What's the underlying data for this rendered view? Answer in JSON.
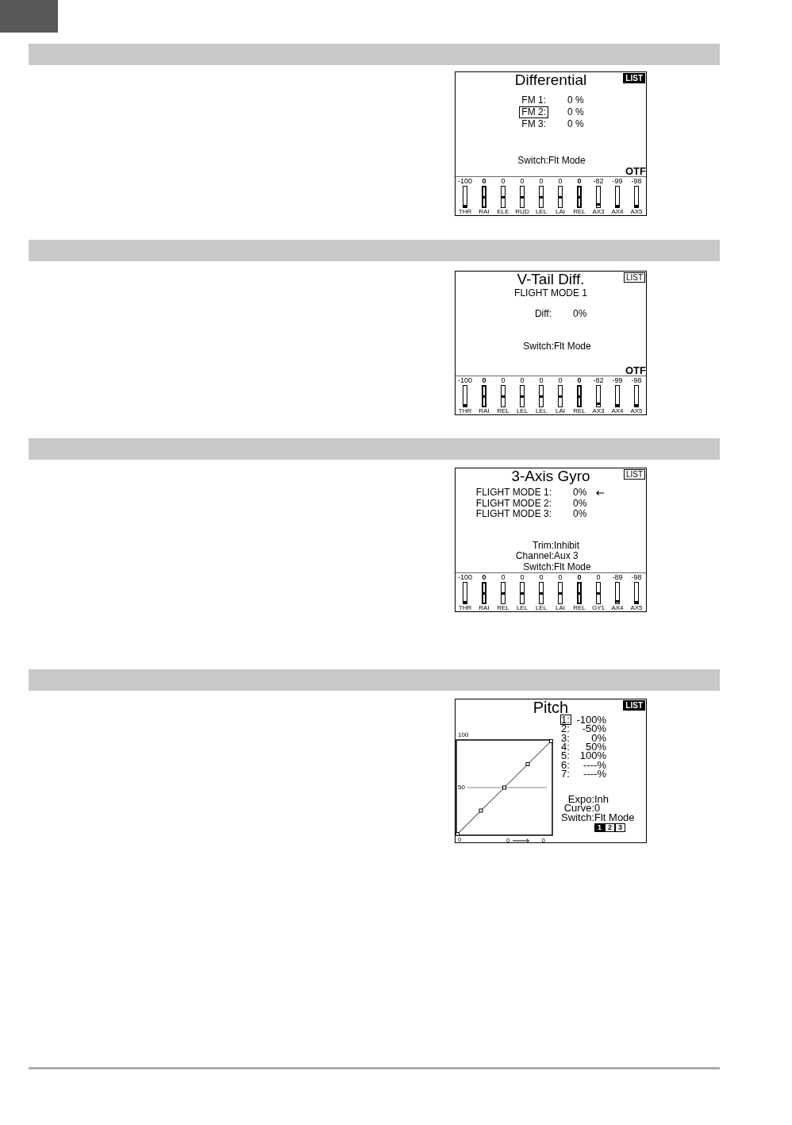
{
  "sections": [
    {
      "screen": {
        "kind": "mix",
        "title": "Differential",
        "list_button": {
          "label": "LIST",
          "selected": true
        },
        "rows": [
          {
            "label": "FM 1:",
            "value": "0 %",
            "selected": false
          },
          {
            "label": "FM 2:",
            "value": "0 %",
            "selected": true
          },
          {
            "label": "FM 3:",
            "value": "0 %",
            "selected": false
          }
        ],
        "settings": [
          {
            "label": "Switch:",
            "value": "Flt Mode"
          }
        ],
        "otf": "OTF",
        "channels": [
          {
            "reading": "-100",
            "name": "THR",
            "level": 0,
            "bold": false
          },
          {
            "reading": "0",
            "name": "RAI",
            "level": 0.5,
            "bold": true
          },
          {
            "reading": "0",
            "name": "ELE",
            "level": 0.5,
            "bold": false
          },
          {
            "reading": "0",
            "name": "RUD",
            "level": 0.5,
            "bold": false
          },
          {
            "reading": "0",
            "name": "LEL",
            "level": 0.5,
            "bold": false
          },
          {
            "reading": "0",
            "name": "LAI",
            "level": 0.5,
            "bold": false
          },
          {
            "reading": "0",
            "name": "REL",
            "level": 0.5,
            "bold": true
          },
          {
            "reading": "-82",
            "name": "AX3",
            "level": 0.09,
            "bold": false
          },
          {
            "reading": "-99",
            "name": "AX4",
            "level": 0.005,
            "bold": false
          },
          {
            "reading": "-98",
            "name": "AX5",
            "level": 0.01,
            "bold": false
          }
        ]
      }
    },
    {
      "screen": {
        "kind": "mix",
        "title": "V-Tail Diff.",
        "subtitle": "FLIGHT MODE 1",
        "list_button": {
          "label": "LIST",
          "selected": false
        },
        "rows": [
          {
            "label": "Diff:",
            "value": "0%",
            "selected": false
          }
        ],
        "settings": [
          {
            "label": "Switch:",
            "value": "Flt Mode"
          }
        ],
        "otf": "OTF",
        "channels": [
          {
            "reading": "-100",
            "name": "THR",
            "level": 0,
            "bold": false
          },
          {
            "reading": "0",
            "name": "RAI",
            "level": 0.5,
            "bold": true
          },
          {
            "reading": "0",
            "name": "REL",
            "level": 0.5,
            "bold": false
          },
          {
            "reading": "0",
            "name": "LEL",
            "level": 0.5,
            "bold": false
          },
          {
            "reading": "0",
            "name": "LEL",
            "level": 0.5,
            "bold": false
          },
          {
            "reading": "0",
            "name": "LAI",
            "level": 0.5,
            "bold": false
          },
          {
            "reading": "0",
            "name": "REL",
            "level": 0.5,
            "bold": true
          },
          {
            "reading": "-82",
            "name": "AX3",
            "level": 0.09,
            "bold": false
          },
          {
            "reading": "-99",
            "name": "AX4",
            "level": 0.005,
            "bold": false
          },
          {
            "reading": "-98",
            "name": "AX5",
            "level": 0.01,
            "bold": false
          }
        ]
      }
    },
    {
      "screen": {
        "kind": "mix",
        "title": "3-Axis Gyro",
        "list_button": {
          "label": "LIST",
          "selected": false
        },
        "rows": [
          {
            "label": "FLIGHT MODE 1:",
            "value": "0%",
            "selected": false,
            "active": true
          },
          {
            "label": "FLIGHT MODE 2:",
            "value": "0%",
            "selected": false,
            "active": false
          },
          {
            "label": "FLIGHT MODE 3:",
            "value": "0%",
            "selected": false,
            "active": false
          }
        ],
        "settings": [
          {
            "label": "Trim:",
            "value": "Inhibit"
          },
          {
            "label": "Channel:",
            "value": "Aux 3"
          },
          {
            "label": "Switch:",
            "value": "Flt Mode"
          }
        ],
        "channels": [
          {
            "reading": "-100",
            "name": "THR",
            "level": 0,
            "bold": false
          },
          {
            "reading": "0",
            "name": "RAI",
            "level": 0.5,
            "bold": true
          },
          {
            "reading": "0",
            "name": "REL",
            "level": 0.5,
            "bold": false
          },
          {
            "reading": "0",
            "name": "LEL",
            "level": 0.5,
            "bold": false
          },
          {
            "reading": "0",
            "name": "LEL",
            "level": 0.5,
            "bold": false
          },
          {
            "reading": "0",
            "name": "LAI",
            "level": 0.5,
            "bold": false
          },
          {
            "reading": "0",
            "name": "REL",
            "level": 0.5,
            "bold": true
          },
          {
            "reading": "0",
            "name": "GY1",
            "level": 0.5,
            "bold": false
          },
          {
            "reading": "-89",
            "name": "AX4",
            "level": 0.055,
            "bold": false
          },
          {
            "reading": "-98",
            "name": "AX5",
            "level": 0.01,
            "bold": false
          }
        ]
      }
    },
    {
      "screen": {
        "kind": "curve",
        "title": "Pitch",
        "list_button": {
          "label": "LIST",
          "selected": true
        },
        "graph": {
          "axis_labels": [
            "100",
            "50",
            "0"
          ]
        },
        "readout": {
          "input": "0",
          "output": "0"
        },
        "points": [
          {
            "label": "1:",
            "value": "-100%",
            "selected": true
          },
          {
            "label": "2:",
            "value": "-50%",
            "selected": false
          },
          {
            "label": "3:",
            "value": "0%",
            "selected": false
          },
          {
            "label": "4:",
            "value": "50%",
            "selected": false
          },
          {
            "label": "5:",
            "value": "100%",
            "selected": false
          },
          {
            "label": "6:",
            "value": "----%",
            "selected": false
          },
          {
            "label": "7:",
            "value": "----%",
            "selected": false
          }
        ],
        "settings": [
          {
            "label": "Expo:",
            "value": "Inh"
          },
          {
            "label": "Curve:",
            "value": "0"
          },
          {
            "label": "Switch:",
            "value": "Flt Mode"
          }
        ],
        "flight_modes": [
          {
            "label": "1",
            "selected": true
          },
          {
            "label": "2",
            "selected": false
          },
          {
            "label": "3",
            "selected": false
          }
        ]
      }
    }
  ]
}
